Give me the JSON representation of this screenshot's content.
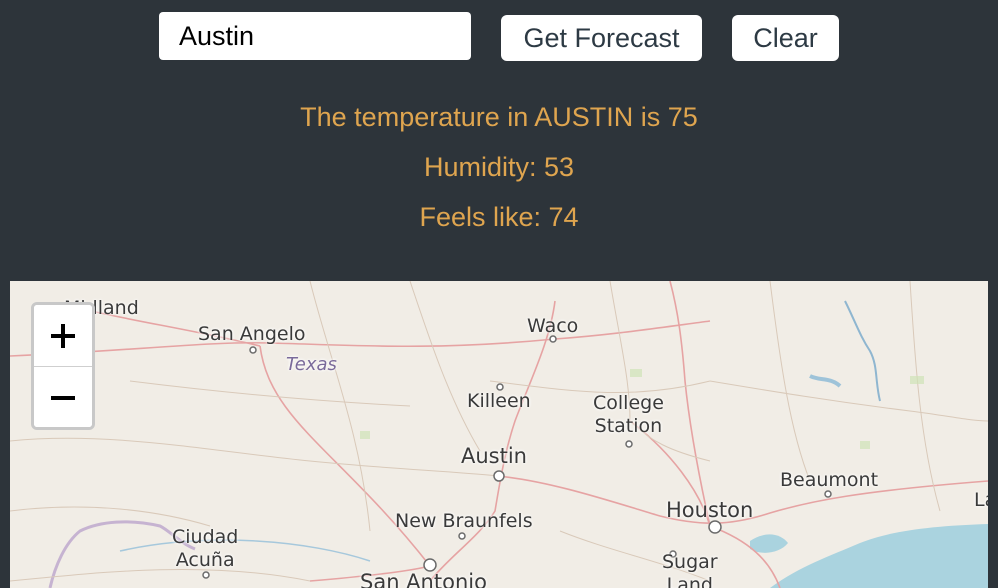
{
  "search": {
    "value": "Austin",
    "placeholder": ""
  },
  "buttons": {
    "forecast": "Get Forecast",
    "clear": "Clear"
  },
  "weather": {
    "temperature_line": "The temperature in AUSTIN is 75",
    "humidity_line": "Humidity: 53",
    "feels_like_line": "Feels like: 74"
  },
  "colors": {
    "background": "#2d343a",
    "info_text": "#dfa54f",
    "water": "#aad3df"
  },
  "map": {
    "zoom_in": "+",
    "zoom_out": "−",
    "labels": {
      "midland": "Midland",
      "san_angelo": "San Angelo",
      "texas": "Texas",
      "waco": "Waco",
      "killeen": "Killeen",
      "college_station": "College\nStation",
      "austin": "Austin",
      "beaumont": "Beaumont",
      "houston": "Houston",
      "new_braunfels": "New Braunfels",
      "ciudad_acuna": "Ciudad\nAcuña",
      "sugar_land": "Sugar\nLand",
      "san_antonio": "San Antonio",
      "edge_label": "La"
    }
  }
}
